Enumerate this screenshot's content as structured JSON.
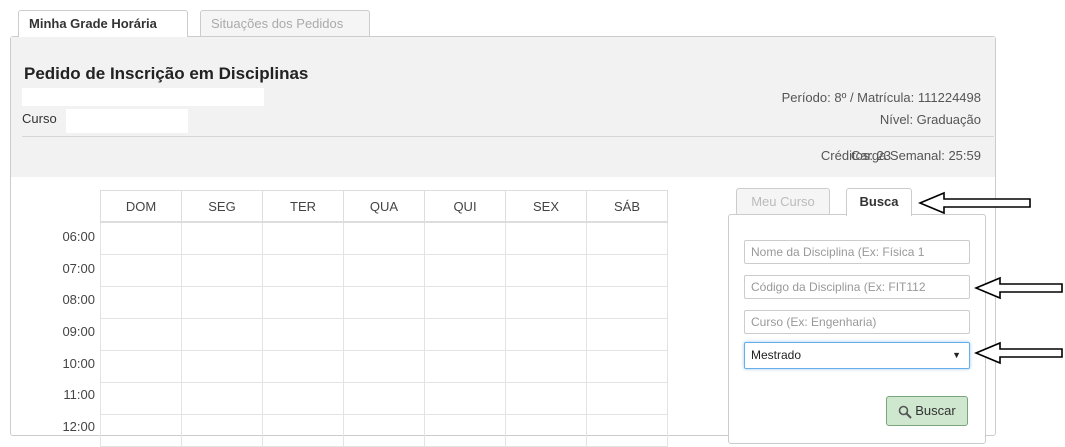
{
  "tabs": [
    {
      "label": "Minha Grade Horária",
      "active": true
    },
    {
      "label": "Situações dos Pedidos",
      "active": false
    }
  ],
  "header": {
    "title": "Pedido de Inscrição em Disciplinas",
    "curso_label": "Curso",
    "periodo": "Período: 8º / Matrícula: 111224498",
    "nivel": "Nível: Graduação",
    "creditos": "Créditos: 23",
    "carga": "Carga Semanal: 25:59"
  },
  "schedule": {
    "days": [
      "DOM",
      "SEG",
      "TER",
      "QUA",
      "QUI",
      "SEX",
      "SÁB"
    ],
    "times": [
      "06:00",
      "07:00",
      "08:00",
      "09:00",
      "10:00",
      "11:00",
      "12:00"
    ]
  },
  "search": {
    "tabs": [
      {
        "label": "Meu Curso",
        "active": false
      },
      {
        "label": "Busca",
        "active": true
      }
    ],
    "nome_placeholder": "Nome da Disciplina (Ex: Física 1",
    "codigo_placeholder": "Código da Disciplina (Ex: FIT112",
    "curso_placeholder": "Curso (Ex: Engenharia)",
    "nivel_selected": "Mestrado",
    "buscar_label": "Buscar"
  },
  "colors": {
    "header_bg": "#f2f2f2",
    "button_bg": "#cfe6cf",
    "select_focus": "#66afe9"
  }
}
